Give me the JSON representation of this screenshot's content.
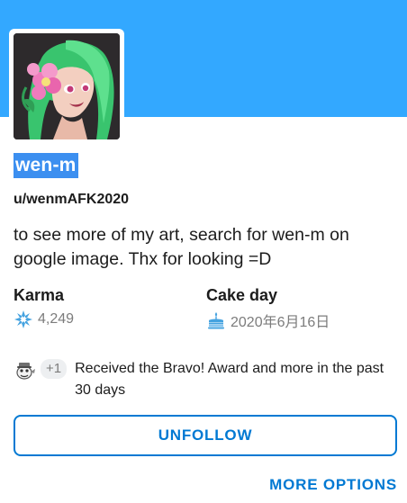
{
  "profile": {
    "display_name": "wen-m",
    "username": "u/wenmAFK2020",
    "bio": "to see more of my art, search for wen-m on google image. Thx for looking =D"
  },
  "stats": {
    "karma_label": "Karma",
    "karma_value": "4,249",
    "karma_icon": "karma-star-icon",
    "cake_label": "Cake day",
    "cake_value": "2020年6月16日",
    "cake_icon": "cake-icon"
  },
  "awards": {
    "icon": "bravo-award-icon",
    "count": "+1",
    "text": "Received the Bravo! Award and more in the past 30 days"
  },
  "actions": {
    "unfollow_label": "UNFOLLOW",
    "more_options_label": "MORE OPTIONS"
  },
  "colors": {
    "banner": "#33a8ff",
    "accent": "#0079d3",
    "selection": "#3c8ff0",
    "avatar_bg": "#2d2a2c",
    "hair": "#3fd07a"
  }
}
